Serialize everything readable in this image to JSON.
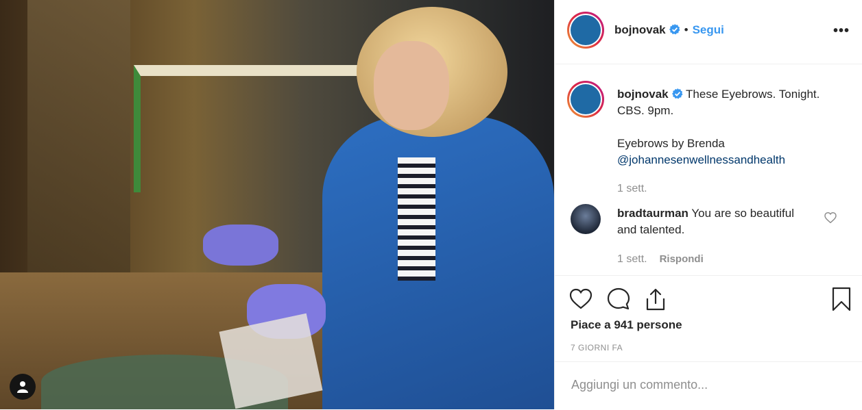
{
  "post": {
    "username": "bojnovak",
    "follow_label": "Segui",
    "separator": "•",
    "more_label": "•••",
    "caption_lines": [
      "These Eyebrows. Tonight.",
      "CBS. 9pm.",
      "",
      "Eyebrows by Brenda"
    ],
    "caption_mention": "@johannesenwellnessandhealth",
    "caption_time": "1 sett."
  },
  "comment": {
    "username": "bradtaurman",
    "text": "You are so beautiful and talented.",
    "time": "1 sett.",
    "reply_label": "Rispondi"
  },
  "actions": {
    "likes_text": "Piace a 941 persone",
    "posted_when": "7 GIORNI FA",
    "add_comment_placeholder": "Aggiungi un commento..."
  },
  "icons": [
    "heart-icon",
    "comment-icon",
    "share-icon",
    "bookmark-icon",
    "verified-icon",
    "user-tag-icon",
    "more-options-icon"
  ],
  "colors": {
    "accent": "#3897f0",
    "mention": "#00376b",
    "muted": "#8e8e8e",
    "verified": "#3897f0"
  }
}
